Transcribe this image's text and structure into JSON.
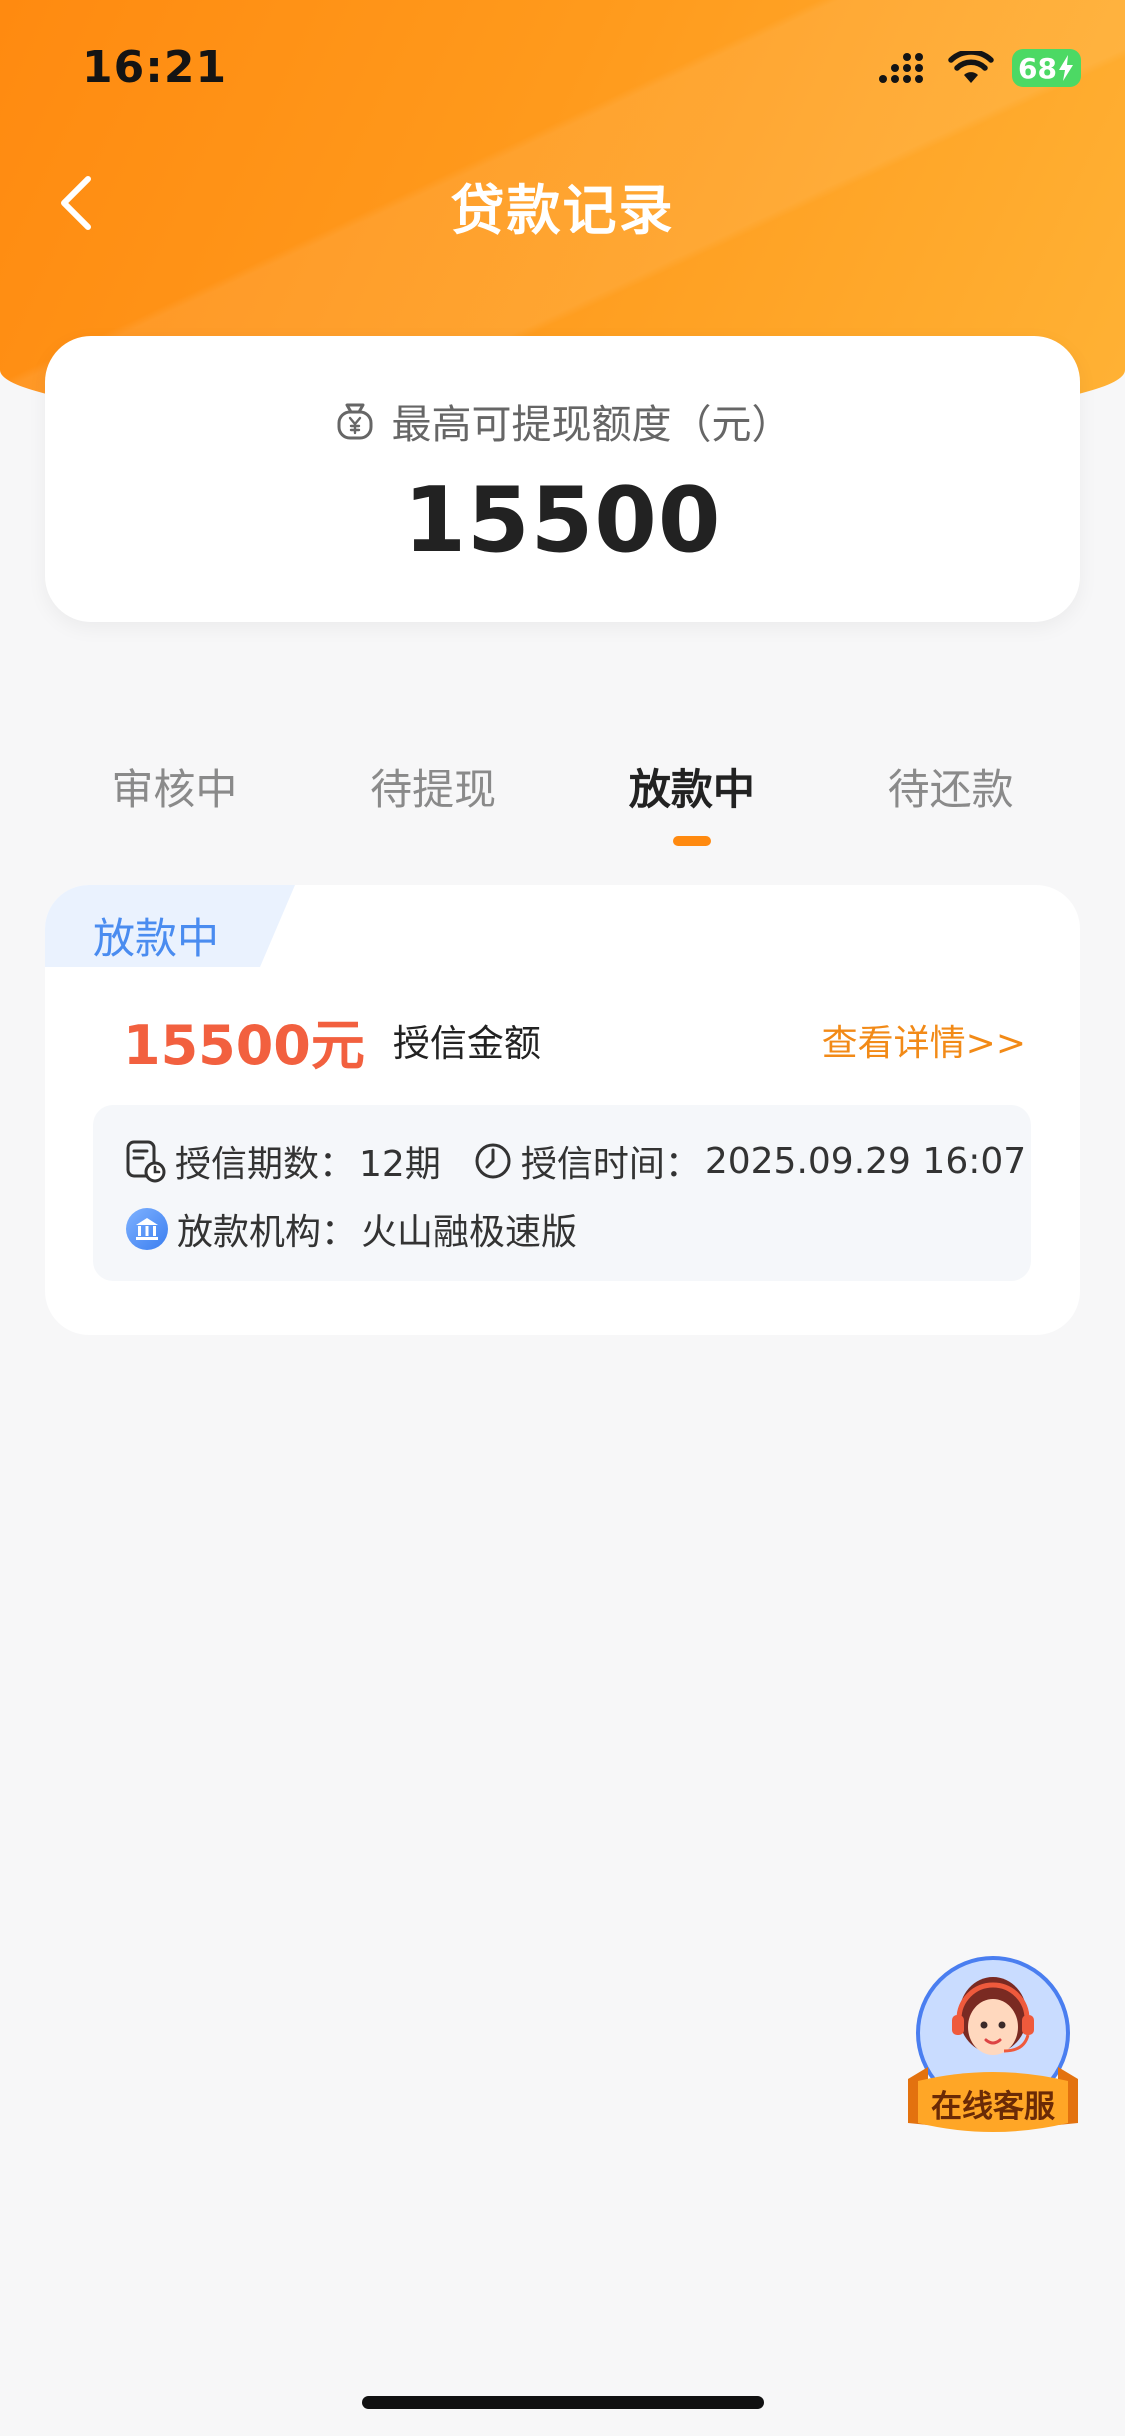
{
  "status_bar": {
    "time": "16:21",
    "battery": "68"
  },
  "nav": {
    "title": "贷款记录"
  },
  "quota": {
    "label": "最高可提现额度（元）",
    "value": "15500"
  },
  "tabs": [
    {
      "label": "审核中",
      "active": false
    },
    {
      "label": "待提现",
      "active": false
    },
    {
      "label": "放款中",
      "active": true
    },
    {
      "label": "待还款",
      "active": false
    }
  ],
  "record": {
    "status": "放款中",
    "amount": "15500元",
    "amount_label": "授信金额",
    "detail_link": "查看详情>>",
    "periods_label": "授信期数：",
    "periods_value": "12期",
    "time_label": "授信时间：",
    "time_value": "2025.09.29 16:07",
    "institution_label": "放款机构：",
    "institution_value": "火山融极速版"
  },
  "service": {
    "label": "在线客服"
  },
  "colors": {
    "brand_orange": "#ff8a10",
    "amount_red": "#f2603f",
    "tag_blue": "#4a8cf0",
    "link_orange": "#f28a17"
  }
}
